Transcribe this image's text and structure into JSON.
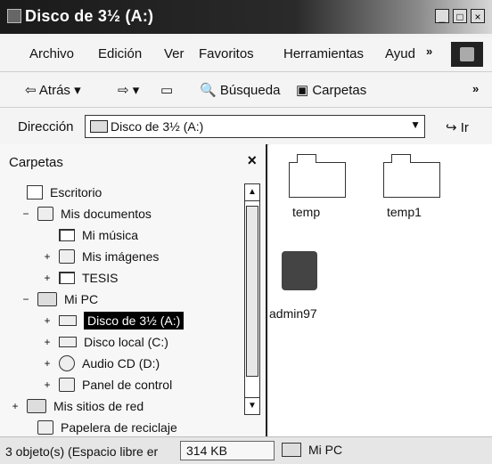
{
  "window": {
    "title": "Disco de 3½ (A:)",
    "buttons": [
      "_",
      "□",
      "×"
    ]
  },
  "menu": {
    "items": [
      "Archivo",
      "Edición",
      "Ver",
      "Favoritos",
      "Herramientas",
      "Ayud"
    ],
    "overflow": "»"
  },
  "toolbar": {
    "back": "Atrás",
    "search": "Búsqueda",
    "folders": "Carpetas",
    "overflow": "»"
  },
  "address": {
    "label": "Dirección",
    "value": "Disco de 3½ (A:)",
    "go": "Ir"
  },
  "left_pane": {
    "title": "Carpetas",
    "tree": [
      {
        "label": "Escritorio",
        "level": 0,
        "toggle": "",
        "icon": "desktop-icon"
      },
      {
        "label": "Mis documentos",
        "level": 1,
        "toggle": "−",
        "icon": "documents-icon"
      },
      {
        "label": "Mi música",
        "level": 2,
        "toggle": "",
        "icon": "folder-icon"
      },
      {
        "label": "Mis imágenes",
        "level": 2,
        "toggle": "+",
        "icon": "pictures-icon"
      },
      {
        "label": "TESIS",
        "level": 2,
        "toggle": "+",
        "icon": "folder-icon"
      },
      {
        "label": "Mi PC",
        "level": 1,
        "toggle": "−",
        "icon": "computer-icon"
      },
      {
        "label": "Disco de 3½ (A:)",
        "level": 2,
        "toggle": "+",
        "icon": "floppy-icon",
        "selected": true
      },
      {
        "label": "Disco local (C:)",
        "level": 2,
        "toggle": "+",
        "icon": "hard-disk-icon"
      },
      {
        "label": "Audio CD (D:)",
        "level": 2,
        "toggle": "+",
        "icon": "cd-icon"
      },
      {
        "label": "Panel de control",
        "level": 2,
        "toggle": "+",
        "icon": "control-panel-icon"
      },
      {
        "label": "Mis sitios de red",
        "level": 1,
        "toggle": "+",
        "icon": "network-icon"
      },
      {
        "label": "Papelera de reciclaje",
        "level": 1,
        "toggle": "",
        "icon": "recycle-bin-icon"
      }
    ]
  },
  "right_pane": {
    "items": [
      {
        "label": "temp",
        "icon": "folder-icon"
      },
      {
        "label": "temp1",
        "icon": "folder-icon"
      },
      {
        "label": "admin97",
        "icon": "setup-icon"
      }
    ]
  },
  "status": {
    "left": "3 objeto(s) (Espacio libre er",
    "middle": "314 KB",
    "right": "Mi PC"
  }
}
